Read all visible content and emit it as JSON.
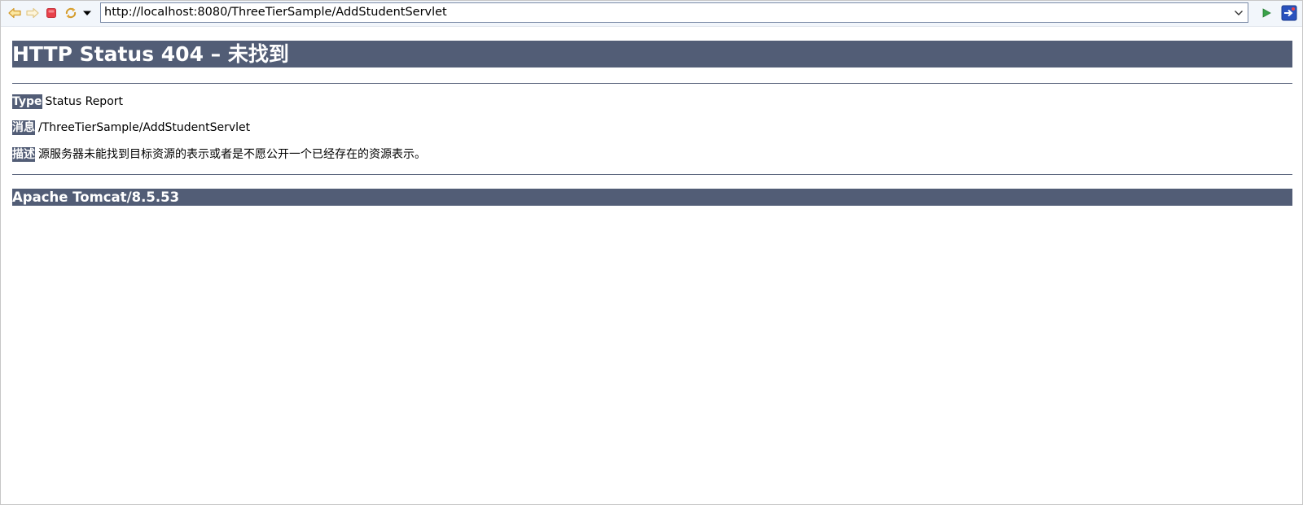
{
  "toolbar": {
    "back_icon": "arrow-left-icon",
    "forward_icon": "arrow-right-icon",
    "stop_icon": "stop-icon",
    "refresh_icon": "refresh-icon",
    "menu_icon": "triangle-down-icon",
    "go_icon": "play-icon",
    "browser_icon": "browser-external-icon",
    "url": "http://localhost:8080/ThreeTierSample/AddStudentServlet",
    "dropdown_icon": "chevron-down-icon"
  },
  "page": {
    "title": "HTTP Status 404 – 未找到",
    "type_label": "Type",
    "type_value": "Status Report",
    "message_label": "消息",
    "message_value": "/ThreeTierSample/AddStudentServlet",
    "description_label": "描述",
    "description_value": "源服务器未能找到目标资源的表示或者是不愿公开一个已经存在的资源表示。",
    "footer": "Apache Tomcat/8.5.53"
  },
  "colors": {
    "header_bg": "#525d76",
    "header_text": "#ffffff"
  }
}
